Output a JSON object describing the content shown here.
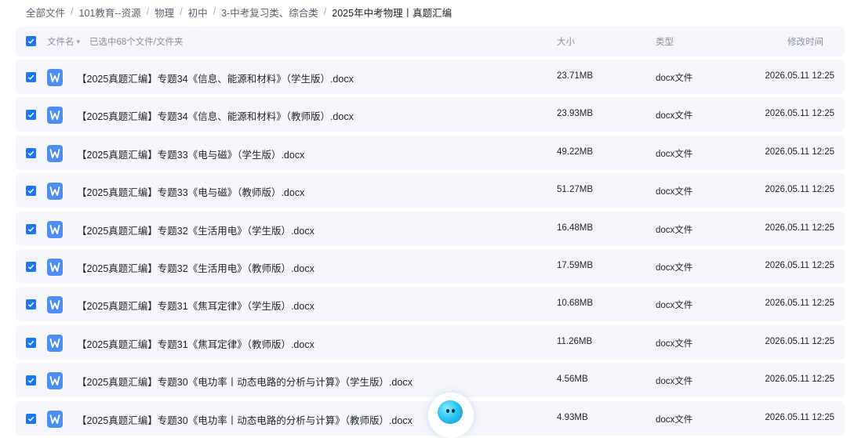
{
  "breadcrumb": [
    "全部文件",
    "101教育--资源",
    "物理",
    "初中",
    "3-中考复习类、综合类",
    "2025年中考物理丨真题汇编"
  ],
  "header": {
    "name": "文件名",
    "selected": "已选中68个文件/文件夹",
    "size": "大小",
    "type": "类型",
    "mtime": "修改时间"
  },
  "files": [
    {
      "name": "【2025真题汇编】专题34《信息、能源和材料》（学生版）.docx",
      "size": "23.71MB",
      "type": "docx文件",
      "mtime": "2026.05.11 12:25",
      "checked": true
    },
    {
      "name": "【2025真题汇编】专题34《信息、能源和材料》（教师版）.docx",
      "size": "23.93MB",
      "type": "docx文件",
      "mtime": "2026.05.11 12:25",
      "checked": true
    },
    {
      "name": "【2025真题汇编】专题33《电与磁》（学生版）.docx",
      "size": "49.22MB",
      "type": "docx文件",
      "mtime": "2026.05.11 12:25",
      "checked": true
    },
    {
      "name": "【2025真题汇编】专题33《电与磁》（教师版）.docx",
      "size": "51.27MB",
      "type": "docx文件",
      "mtime": "2026.05.11 12:25",
      "checked": true
    },
    {
      "name": "【2025真题汇编】专题32《生活用电》（学生版）.docx",
      "size": "16.48MB",
      "type": "docx文件",
      "mtime": "2026.05.11 12:25",
      "checked": true
    },
    {
      "name": "【2025真题汇编】专题32《生活用电》（教师版）.docx",
      "size": "17.59MB",
      "type": "docx文件",
      "mtime": "2026.05.11 12:25",
      "checked": true
    },
    {
      "name": "【2025真题汇编】专题31《焦耳定律》（学生版）.docx",
      "size": "10.68MB",
      "type": "docx文件",
      "mtime": "2026.05.11 12:25",
      "checked": true
    },
    {
      "name": "【2025真题汇编】专题31《焦耳定律》（教师版）.docx",
      "size": "11.26MB",
      "type": "docx文件",
      "mtime": "2026.05.11 12:25",
      "checked": true
    },
    {
      "name": "【2025真题汇编】专题30《电功率丨动态电路的分析与计算》（学生版）.docx",
      "size": "4.56MB",
      "type": "docx文件",
      "mtime": "2026.05.11 12:25",
      "checked": true
    },
    {
      "name": "【2025真题汇编】专题30《电功率丨动态电路的分析与计算》（教师版）.docx",
      "size": "4.93MB",
      "type": "docx文件",
      "mtime": "2026.05.11 12:25",
      "checked": true
    }
  ],
  "colors": {
    "accent": "#1677ff",
    "row_bg": "#f5f6fa",
    "file_icon": "#4c8df6"
  },
  "icons": {
    "checkbox": "checkbox-checked-icon",
    "file": "word-doc-icon",
    "sort": "sort-down-icon",
    "assistant": "ai-assistant-icon"
  }
}
